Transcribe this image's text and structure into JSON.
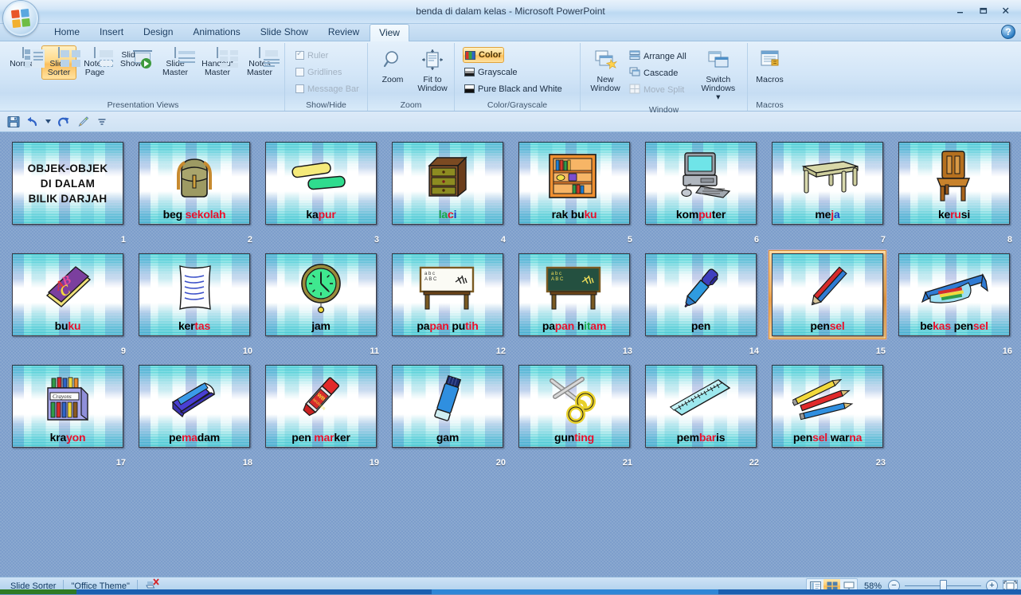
{
  "window": {
    "title": "benda di dalam kelas  -  Microsoft PowerPoint",
    "minimize_label": "Minimize",
    "restore_label": "Restore",
    "close_label": "Close",
    "help_label": "?"
  },
  "ribbon": {
    "tabs": [
      {
        "label": "Home",
        "active": false
      },
      {
        "label": "Insert",
        "active": false
      },
      {
        "label": "Design",
        "active": false
      },
      {
        "label": "Animations",
        "active": false
      },
      {
        "label": "Slide Show",
        "active": false
      },
      {
        "label": "Review",
        "active": false
      },
      {
        "label": "View",
        "active": true
      }
    ],
    "groups": {
      "presentation_views": {
        "label": "Presentation Views",
        "buttons": [
          {
            "label": "Normal",
            "selected": false
          },
          {
            "label": "Slide\nSorter",
            "selected": true
          },
          {
            "label": "Notes\nPage",
            "selected": false
          },
          {
            "label": "Slide\nShow",
            "selected": false
          },
          {
            "label": "Slide\nMaster",
            "selected": false
          },
          {
            "label": "Handout\nMaster",
            "selected": false
          },
          {
            "label": "Notes\nMaster",
            "selected": false
          }
        ]
      },
      "show_hide": {
        "label": "Show/Hide",
        "items": [
          {
            "label": "Ruler",
            "checked": true,
            "dim": true
          },
          {
            "label": "Gridlines",
            "checked": false,
            "dim": true
          },
          {
            "label": "Message Bar",
            "checked": false,
            "dim": true
          }
        ]
      },
      "zoom": {
        "label": "Zoom",
        "buttons": [
          {
            "label": "Zoom"
          },
          {
            "label": "Fit to\nWindow"
          }
        ]
      },
      "color_grayscale": {
        "label": "Color/Grayscale",
        "items": [
          {
            "label": "Color",
            "selected": true
          },
          {
            "label": "Grayscale",
            "selected": false
          },
          {
            "label": "Pure Black and White",
            "selected": false
          }
        ]
      },
      "window": {
        "label": "Window",
        "big": [
          {
            "label": "New\nWindow"
          },
          {
            "label": "Switch\nWindows ▾"
          }
        ],
        "items": [
          {
            "label": "Arrange All",
            "dim": false
          },
          {
            "label": "Cascade",
            "dim": false
          },
          {
            "label": "Move Split",
            "dim": true
          }
        ]
      },
      "macros": {
        "label": "Macros",
        "buttons": [
          {
            "label": "Macros"
          }
        ]
      }
    }
  },
  "quick_access": {
    "items": [
      "save-icon",
      "undo-icon",
      "undo-dropdown-icon",
      "redo-icon",
      "format-painter-icon",
      "customize-qat-icon"
    ]
  },
  "slides": [
    {
      "num": "1",
      "selected": false,
      "title_slide": true,
      "title_lines": [
        "OBJEK-OBJEK",
        "DI DALAM",
        "BILIK DARJAH"
      ],
      "caption": [],
      "art": "none"
    },
    {
      "num": "2",
      "selected": false,
      "art": "backpack",
      "caption": [
        {
          "t": "beg ",
          "c": "#000000"
        },
        {
          "t": "sekolah",
          "c": "#e8112d"
        }
      ]
    },
    {
      "num": "3",
      "selected": false,
      "art": "chalk",
      "caption": [
        {
          "t": "ka",
          "c": "#000000"
        },
        {
          "t": "pur",
          "c": "#e8112d"
        }
      ]
    },
    {
      "num": "4",
      "selected": false,
      "art": "drawer",
      "caption": [
        {
          "t": "la",
          "c": "#1aa84a"
        },
        {
          "t": "c",
          "c": "#e8112d"
        },
        {
          "t": "i",
          "c": "#1f3fbf"
        }
      ]
    },
    {
      "num": "5",
      "selected": false,
      "art": "bookshelf",
      "caption": [
        {
          "t": "rak bu",
          "c": "#000000"
        },
        {
          "t": "ku",
          "c": "#e8112d"
        }
      ]
    },
    {
      "num": "6",
      "selected": false,
      "art": "computer",
      "caption": [
        {
          "t": "kom",
          "c": "#000000"
        },
        {
          "t": "pu",
          "c": "#e8112d"
        },
        {
          "t": "ter",
          "c": "#000000"
        }
      ]
    },
    {
      "num": "7",
      "selected": false,
      "art": "table",
      "caption": [
        {
          "t": "me",
          "c": "#000000"
        },
        {
          "t": "j",
          "c": "#e8112d"
        },
        {
          "t": "a",
          "c": "#1f3fbf"
        }
      ]
    },
    {
      "num": "8",
      "selected": false,
      "art": "chair",
      "caption": [
        {
          "t": "ke",
          "c": "#000000"
        },
        {
          "t": "ru",
          "c": "#e8112d"
        },
        {
          "t": "si",
          "c": "#000000"
        }
      ]
    },
    {
      "num": "9",
      "selected": false,
      "art": "book",
      "caption": [
        {
          "t": "bu",
          "c": "#000000"
        },
        {
          "t": "ku",
          "c": "#e8112d"
        }
      ]
    },
    {
      "num": "10",
      "selected": false,
      "art": "paper",
      "caption": [
        {
          "t": "ker",
          "c": "#000000"
        },
        {
          "t": "tas",
          "c": "#e8112d"
        }
      ]
    },
    {
      "num": "11",
      "selected": false,
      "art": "clock",
      "caption": [
        {
          "t": "jam",
          "c": "#000000"
        }
      ]
    },
    {
      "num": "12",
      "selected": false,
      "art": "whiteboard",
      "caption": [
        {
          "t": "pa",
          "c": "#000000"
        },
        {
          "t": "pan",
          "c": "#e8112d"
        },
        {
          "t": " pu",
          "c": "#000000"
        },
        {
          "t": "tih",
          "c": "#e8112d"
        }
      ]
    },
    {
      "num": "13",
      "selected": false,
      "art": "blackboard",
      "caption": [
        {
          "t": "pa",
          "c": "#000000"
        },
        {
          "t": "pan",
          "c": "#e8112d"
        },
        {
          "t": " h",
          "c": "#000000"
        },
        {
          "t": "it",
          "c": "#1aa84a"
        },
        {
          "t": "am",
          "c": "#e8112d"
        }
      ]
    },
    {
      "num": "14",
      "selected": false,
      "art": "pen",
      "caption": [
        {
          "t": "pen",
          "c": "#000000"
        }
      ]
    },
    {
      "num": "15",
      "selected": true,
      "art": "pencil",
      "caption": [
        {
          "t": "pen",
          "c": "#000000"
        },
        {
          "t": "sel",
          "c": "#e8112d"
        }
      ]
    },
    {
      "num": "16",
      "selected": false,
      "art": "pencilcase",
      "caption": [
        {
          "t": "be",
          "c": "#000000"
        },
        {
          "t": "kas",
          "c": "#e8112d"
        },
        {
          "t": " pen",
          "c": "#000000"
        },
        {
          "t": "sel",
          "c": "#e8112d"
        }
      ]
    },
    {
      "num": "17",
      "selected": false,
      "art": "crayons",
      "caption": [
        {
          "t": "kra",
          "c": "#000000"
        },
        {
          "t": "yon",
          "c": "#e8112d"
        }
      ]
    },
    {
      "num": "18",
      "selected": false,
      "art": "eraser",
      "caption": [
        {
          "t": "pe",
          "c": "#000000"
        },
        {
          "t": "ma",
          "c": "#e8112d"
        },
        {
          "t": "dam",
          "c": "#000000"
        }
      ]
    },
    {
      "num": "19",
      "selected": false,
      "art": "marker",
      "caption": [
        {
          "t": "pen ",
          "c": "#000000"
        },
        {
          "t": "mar",
          "c": "#e8112d"
        },
        {
          "t": "ker",
          "c": "#000000"
        }
      ]
    },
    {
      "num": "20",
      "selected": false,
      "art": "glue",
      "caption": [
        {
          "t": "gam",
          "c": "#000000"
        }
      ]
    },
    {
      "num": "21",
      "selected": false,
      "art": "scissors",
      "caption": [
        {
          "t": "gun",
          "c": "#000000"
        },
        {
          "t": "ting",
          "c": "#e8112d"
        }
      ]
    },
    {
      "num": "22",
      "selected": false,
      "art": "ruler",
      "caption": [
        {
          "t": "pem",
          "c": "#000000"
        },
        {
          "t": "bar",
          "c": "#e8112d"
        },
        {
          "t": "is",
          "c": "#000000"
        }
      ]
    },
    {
      "num": "23",
      "selected": false,
      "art": "colorpencils",
      "caption": [
        {
          "t": "pen",
          "c": "#000000"
        },
        {
          "t": "sel",
          "c": "#e8112d"
        },
        {
          "t": " war",
          "c": "#000000"
        },
        {
          "t": "na",
          "c": "#e8112d"
        }
      ]
    }
  ],
  "statusbar": {
    "view_name": "Slide Sorter",
    "theme_name": "\"Office Theme\"",
    "spell_icon": "spellcheck-error-icon",
    "zoom_level": "58%",
    "zoom_out_label": "−",
    "zoom_in_label": "+",
    "view_buttons": [
      "normal-view",
      "slide-sorter-view",
      "slide-show-view"
    ],
    "fit_label": "fit-slide-to-window"
  },
  "colors": {
    "accent_orange": "#f5b464",
    "caption_red": "#e8112d",
    "caption_green": "#1aa84a",
    "caption_blue": "#1f3fbf",
    "workspace": "#7d9ecb"
  }
}
